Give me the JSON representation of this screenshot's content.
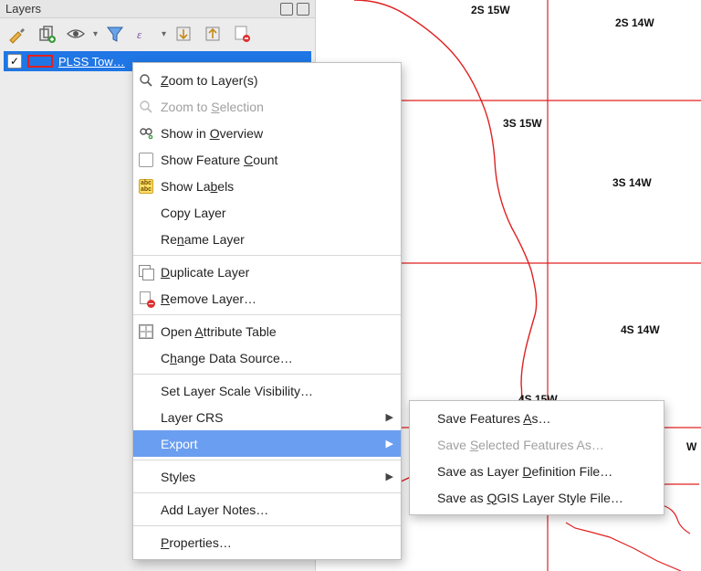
{
  "panel": {
    "title": "Layers"
  },
  "layer": {
    "name": "PLSS Tow…",
    "checked": "✓"
  },
  "ctx": {
    "zoom_to_layers": "Zoom to Layer(s)",
    "zoom_to_selection": "Zoom to Selection",
    "show_in_overview": "Show in Overview",
    "show_feature_count": "Show Feature Count",
    "show_labels": "Show Labels",
    "copy_layer": "Copy Layer",
    "rename_layer": "Rename Layer",
    "duplicate_layer": "Duplicate Layer",
    "remove_layer": "Remove Layer…",
    "open_attribute_table": "Open Attribute Table",
    "change_data_source": "Change Data Source…",
    "set_visibility": "Set Layer Scale Visibility…",
    "layer_crs": "Layer CRS",
    "export": "Export",
    "styles": "Styles",
    "add_layer_notes": "Add Layer Notes…",
    "properties": "Properties…"
  },
  "submenu": {
    "save_features_as": "Save Features As…",
    "save_selected_features_as": "Save Selected Features As…",
    "save_layer_def": "Save as Layer Definition File…",
    "save_qgis_style": "Save as QGIS Layer Style File…"
  },
  "map_labels": {
    "l_2s15w": "2S 15W",
    "l_2s14w": "2S 14W",
    "l_3s15w": "3S 15W",
    "l_3s14w": "3S 14W",
    "l_4s14w": "4S 14W",
    "l_4s15w": "4S 15W",
    "l_14w_partial": "W"
  }
}
